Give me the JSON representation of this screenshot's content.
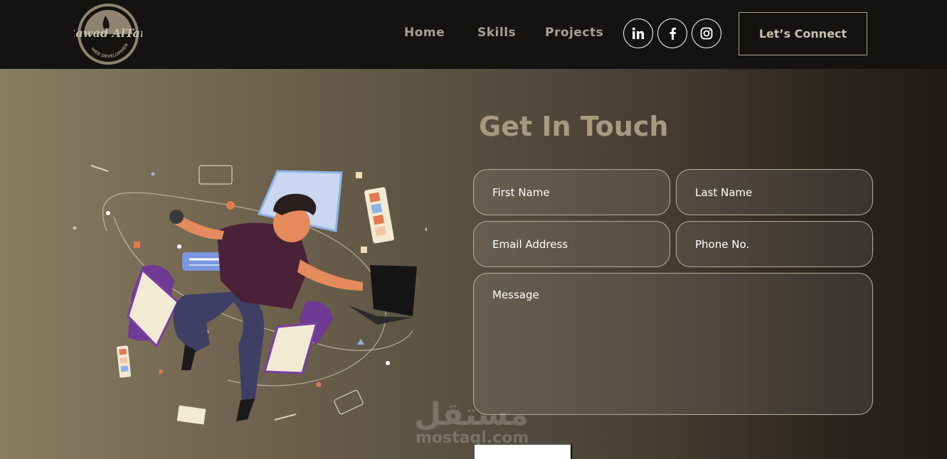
{
  "brand": {
    "logo_line1": "Rawad AlTari",
    "logo_line2": "WEB DEVELOPMENT"
  },
  "nav": {
    "links": [
      "Home",
      "Skills",
      "Projects"
    ],
    "social_icons": [
      "linkedin-icon",
      "facebook-icon",
      "instagram-icon"
    ],
    "cta_label": "Let’s Connect"
  },
  "contact": {
    "title": "Get In Touch",
    "first_name_placeholder": "First Name",
    "last_name_placeholder": "Last Name",
    "email_placeholder": "Email Address",
    "phone_placeholder": "Phone No.",
    "message_placeholder": "Message"
  },
  "watermark": {
    "arabic": "مستقل",
    "latin": "mostaql.com"
  },
  "colors": {
    "navbar_bg": "#141312",
    "nav_link": "#a8a090",
    "title": "#a89a80",
    "field_border": "#b8ad98"
  }
}
